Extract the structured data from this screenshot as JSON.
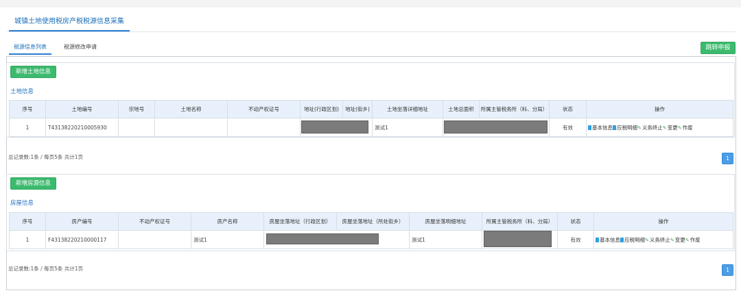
{
  "page_tab": "城镇土地使用税房产税税源信息采集",
  "subtabs": {
    "active": "税源信息列表",
    "inactive": "税源修改申请"
  },
  "jump_button": "跳转申报",
  "land": {
    "add_button": "新增土地信息",
    "section_title": "土地信息",
    "headers": [
      "序号",
      "土地编号",
      "宗地号",
      "土地名称",
      "不动产权证号",
      "地址(行政区划)",
      "地址(街乡)",
      "土地坐落详细地址",
      "土地总面积",
      "所属主管税务所（科、分局）",
      "状态",
      "操作"
    ],
    "rows": [
      {
        "seq": "1",
        "code": "T43138220210005930",
        "parcel": "",
        "name": "",
        "cert": "",
        "detail": "测试1",
        "status": "有效"
      }
    ],
    "pager": "总记录数:1条 / 每页5条 共计1页",
    "page": "1"
  },
  "house": {
    "add_button": "新增房源信息",
    "section_title": "房屋信息",
    "headers": [
      "序号",
      "房产编号",
      "不动产权证号",
      "房产名称",
      "房屋坐落地址（行政区划）",
      "房屋坐落地址（所处街乡）",
      "房屋坐落明细地址",
      "所属主管税务所（科、分局）",
      "状态",
      "操作"
    ],
    "rows": [
      {
        "seq": "1",
        "code": "F43138220210000117",
        "cert": "",
        "name": "测试1",
        "detail": "测试1",
        "status": "有效"
      }
    ],
    "pager": "总记录数:1条 / 每页5条 共计1页",
    "page": "1"
  },
  "ops": {
    "basic": "基本信息",
    "tax": "应税明细",
    "terminate": "义务终止",
    "change": "变更",
    "void": "作废"
  },
  "icons": {
    "doc": "document-icon",
    "wrench": "wrench-icon"
  },
  "colors": {
    "accent": "#2a7bd5",
    "green": "#3cba6e",
    "header_bg": "#e8f1fb",
    "redact": "#7b7b7b"
  }
}
